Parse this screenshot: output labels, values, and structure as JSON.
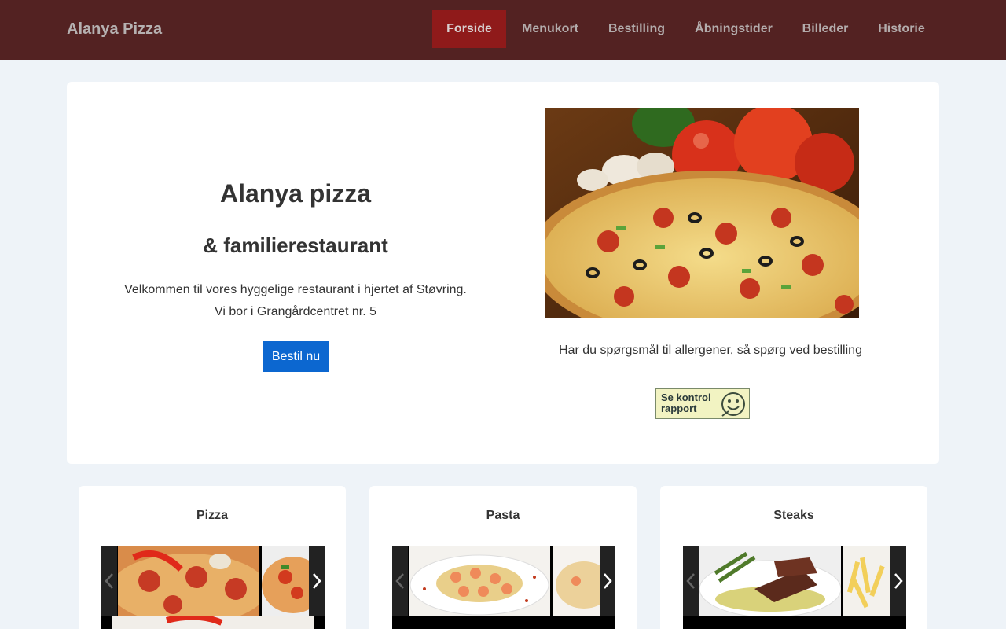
{
  "navbar": {
    "brand": "Alanya Pizza",
    "links": [
      {
        "label": "Forside"
      },
      {
        "label": "Menukort"
      },
      {
        "label": "Bestilling"
      },
      {
        "label": "Åbningstider"
      },
      {
        "label": "Billeder"
      },
      {
        "label": "Historie"
      }
    ],
    "active_index": 0
  },
  "hero": {
    "title": "Alanya pizza",
    "subtitle": "& familierestaurant",
    "text_line1": "Velkommen til vores hyggelige restaurant i hjertet af Støvring.",
    "text_line2": "Vi bor i Grangårdcentret nr. 5",
    "button_label": "Bestil nu",
    "allergen_note": "Har du spørgsmål til allergener, så spørg ved bestilling",
    "kontrol_line1": "Se kontrol",
    "kontrol_line2": "rapport"
  },
  "cards": [
    {
      "title": "Pizza"
    },
    {
      "title": "Pasta"
    },
    {
      "title": "Steaks"
    }
  ],
  "colors": {
    "navbar_bg": "#532222",
    "nav_active_bg": "#8f1a1a",
    "button_bg": "#0c67d0",
    "page_bg": "#eef3f8"
  }
}
